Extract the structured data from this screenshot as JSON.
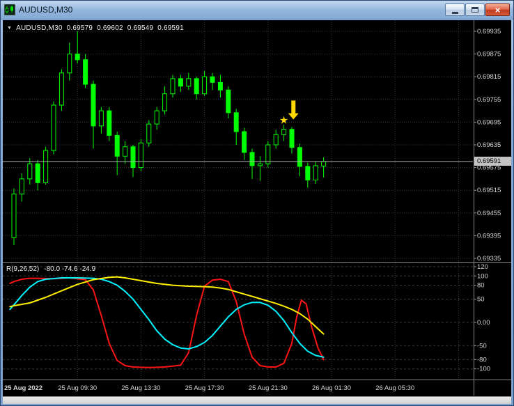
{
  "window": {
    "title": "AUDUSD,M30"
  },
  "titlebar_icons": {
    "close_glyph": "×"
  },
  "legend": {
    "collapse_glyph": "▼",
    "symbol": "AUDUSD,M30",
    "open": "0.69579",
    "high": "0.69602",
    "low": "0.69549",
    "close": "0.69591"
  },
  "indicator_panel": {
    "name": "R(9,26,52)",
    "values": "-80.0 -74.6 -24.9"
  },
  "axes": {
    "price_labels": [
      "0.69935",
      "0.69875",
      "0.69815",
      "0.69755",
      "0.69695",
      "0.69635",
      "0.69575",
      "0.69515",
      "0.69455",
      "0.69395",
      "0.69335"
    ],
    "current_price": "0.69591",
    "indicator_labels": [
      "120",
      "100",
      "80",
      "50",
      "0.00",
      "-50",
      "-80",
      "-100"
    ],
    "time_labels": [
      {
        "text": "25 Aug 2022",
        "bar": 0,
        "type": "date"
      },
      {
        "text": "25 Aug 09:30",
        "bar": 8,
        "type": "time"
      },
      {
        "text": "25 Aug 13:30",
        "bar": 16,
        "type": "time"
      },
      {
        "text": "25 Aug 17:30",
        "bar": 24,
        "type": "time"
      },
      {
        "text": "25 Aug 21:30",
        "bar": 32,
        "type": "time"
      },
      {
        "text": "26 Aug 01:30",
        "bar": 40,
        "type": "time"
      },
      {
        "text": "26 Aug 05:30",
        "bar": 48,
        "type": "time"
      }
    ]
  },
  "chart_data": {
    "type": "candlestick",
    "symbol": "AUDUSD",
    "timeframe": "M30",
    "price_range": [
      0.69335,
      0.69955
    ],
    "ohlc": [
      [
        0.6939,
        0.6952,
        0.6937,
        0.69505
      ],
      [
        0.69505,
        0.6956,
        0.69485,
        0.69545
      ],
      [
        0.69545,
        0.696,
        0.6953,
        0.69585
      ],
      [
        0.69585,
        0.69595,
        0.69515,
        0.69535
      ],
      [
        0.69535,
        0.6963,
        0.6953,
        0.6962
      ],
      [
        0.6962,
        0.6975,
        0.6961,
        0.6974
      ],
      [
        0.6974,
        0.69835,
        0.69725,
        0.69825
      ],
      [
        0.69825,
        0.69905,
        0.69805,
        0.69875
      ],
      [
        0.69875,
        0.69935,
        0.6985,
        0.6986
      ],
      [
        0.6986,
        0.69875,
        0.69785,
        0.69795
      ],
      [
        0.69795,
        0.69805,
        0.69625,
        0.69685
      ],
      [
        0.69685,
        0.69735,
        0.69665,
        0.69725
      ],
      [
        0.69725,
        0.69735,
        0.69645,
        0.6966
      ],
      [
        0.6966,
        0.6967,
        0.69555,
        0.69605
      ],
      [
        0.69605,
        0.69645,
        0.69585,
        0.6963
      ],
      [
        0.6963,
        0.69635,
        0.6955,
        0.69575
      ],
      [
        0.69575,
        0.6965,
        0.69565,
        0.6964
      ],
      [
        0.6964,
        0.697,
        0.6963,
        0.6969
      ],
      [
        0.6969,
        0.69735,
        0.69675,
        0.69725
      ],
      [
        0.69725,
        0.6979,
        0.69715,
        0.6977
      ],
      [
        0.6977,
        0.6982,
        0.6976,
        0.6981
      ],
      [
        0.6981,
        0.6982,
        0.69775,
        0.6979
      ],
      [
        0.6979,
        0.69825,
        0.6978,
        0.6981
      ],
      [
        0.6981,
        0.69815,
        0.69755,
        0.6977
      ],
      [
        0.6977,
        0.6983,
        0.69765,
        0.69815
      ],
      [
        0.69815,
        0.69825,
        0.6978,
        0.698
      ],
      [
        0.698,
        0.6982,
        0.6976,
        0.6978
      ],
      [
        0.6978,
        0.6979,
        0.69705,
        0.6972
      ],
      [
        0.6972,
        0.6973,
        0.69635,
        0.6967
      ],
      [
        0.6967,
        0.6968,
        0.69595,
        0.69615
      ],
      [
        0.69615,
        0.69625,
        0.69545,
        0.6958
      ],
      [
        0.6958,
        0.69605,
        0.6954,
        0.69585
      ],
      [
        0.69585,
        0.69645,
        0.69575,
        0.69635
      ],
      [
        0.69635,
        0.69675,
        0.69625,
        0.69662
      ],
      [
        0.69662,
        0.69688,
        0.69645,
        0.69676
      ],
      [
        0.69676,
        0.69682,
        0.69612,
        0.69628
      ],
      [
        0.69628,
        0.69638,
        0.69552,
        0.69578
      ],
      [
        0.69578,
        0.69588,
        0.69522,
        0.69542
      ],
      [
        0.69542,
        0.69592,
        0.69532,
        0.6958
      ],
      [
        0.69579,
        0.69602,
        0.69549,
        0.69591
      ]
    ],
    "oscillator": {
      "label": "R(9,26,52)",
      "range": [
        -120,
        120
      ],
      "series": [
        {
          "name": "r-fast",
          "color": "#ff1414",
          "last": -80.0,
          "points": [
            [
              -0.5,
              84
            ],
            [
              0,
              88
            ],
            [
              1,
              93
            ],
            [
              2,
              95
            ],
            [
              3,
              95
            ],
            [
              5,
              94
            ],
            [
              7,
              96
            ],
            [
              9,
              92
            ],
            [
              10,
              70
            ],
            [
              11,
              15
            ],
            [
              12,
              -45
            ],
            [
              13,
              -82
            ],
            [
              14,
              -93
            ],
            [
              15,
              -96
            ],
            [
              17,
              -97
            ],
            [
              19,
              -96
            ],
            [
              21,
              -92
            ],
            [
              22,
              -65
            ],
            [
              23,
              15
            ],
            [
              24,
              78
            ],
            [
              25,
              91
            ],
            [
              26,
              93
            ],
            [
              27,
              88
            ],
            [
              28,
              45
            ],
            [
              29,
              -25
            ],
            [
              30,
              -75
            ],
            [
              31,
              -93
            ],
            [
              32,
              -96
            ],
            [
              33,
              -96
            ],
            [
              34,
              -88
            ],
            [
              35,
              -45
            ],
            [
              35.6,
              10
            ],
            [
              36.2,
              48
            ],
            [
              36.8,
              40
            ],
            [
              37.5,
              -10
            ],
            [
              38.3,
              -55
            ],
            [
              39,
              -80
            ]
          ]
        },
        {
          "name": "r-mid",
          "color": "#00f5ff",
          "last": -74.6,
          "points": [
            [
              -0.5,
              28
            ],
            [
              0,
              38
            ],
            [
              1,
              58
            ],
            [
              2,
              76
            ],
            [
              3,
              88
            ],
            [
              4,
              93
            ],
            [
              6,
              96
            ],
            [
              8,
              96
            ],
            [
              10,
              95
            ],
            [
              11,
              93
            ],
            [
              12,
              88
            ],
            [
              13,
              80
            ],
            [
              14,
              67
            ],
            [
              15,
              50
            ],
            [
              16,
              28
            ],
            [
              17,
              6
            ],
            [
              18,
              -18
            ],
            [
              19,
              -36
            ],
            [
              20,
              -48
            ],
            [
              21,
              -55
            ],
            [
              22,
              -57
            ],
            [
              23,
              -52
            ],
            [
              24,
              -43
            ],
            [
              25,
              -28
            ],
            [
              26,
              -8
            ],
            [
              27,
              12
            ],
            [
              28,
              28
            ],
            [
              29,
              38
            ],
            [
              30,
              43
            ],
            [
              31,
              43
            ],
            [
              32,
              37
            ],
            [
              33,
              24
            ],
            [
              34,
              4
            ],
            [
              35,
              -22
            ],
            [
              36,
              -45
            ],
            [
              37,
              -62
            ],
            [
              38,
              -71
            ],
            [
              39,
              -74.6
            ]
          ]
        },
        {
          "name": "r-slow",
          "color": "#ffef00",
          "last": -24.9,
          "points": [
            [
              -0.5,
              34
            ],
            [
              0,
              36
            ],
            [
              2,
              42
            ],
            [
              4,
              54
            ],
            [
              6,
              68
            ],
            [
              8,
              82
            ],
            [
              10,
              92
            ],
            [
              12,
              97
            ],
            [
              13,
              98
            ],
            [
              14,
              96
            ],
            [
              15,
              93
            ],
            [
              16,
              90
            ],
            [
              17,
              87
            ],
            [
              18,
              84
            ],
            [
              19,
              82
            ],
            [
              20,
              80
            ],
            [
              22,
              78
            ],
            [
              24,
              77
            ],
            [
              25,
              76
            ],
            [
              26,
              74
            ],
            [
              27,
              71
            ],
            [
              28,
              66
            ],
            [
              29,
              61
            ],
            [
              30,
              56
            ],
            [
              31,
              51
            ],
            [
              32,
              46
            ],
            [
              33,
              41
            ],
            [
              34,
              35
            ],
            [
              35,
              28
            ],
            [
              36,
              19
            ],
            [
              37,
              7
            ],
            [
              38,
              -9
            ],
            [
              39,
              -24.9
            ]
          ]
        }
      ]
    },
    "markers": {
      "star": {
        "glyph": "★",
        "bar": 34,
        "price": 0.697,
        "color": "#ffd700"
      },
      "arrow_down": {
        "bar": 35.2,
        "price_top": 0.69752,
        "price_tip": 0.69702,
        "color": "#ffd700"
      }
    }
  },
  "colors": {
    "chart_bg": "#000000",
    "grid": "#3a3a3a",
    "candle": "#00ff00",
    "current_price_line": "#aeaeae",
    "axis_text": "#d6d6d6",
    "separator": "#8a8a8a",
    "badge_bg": "#c3c3c3",
    "badge_text": "#000000"
  }
}
